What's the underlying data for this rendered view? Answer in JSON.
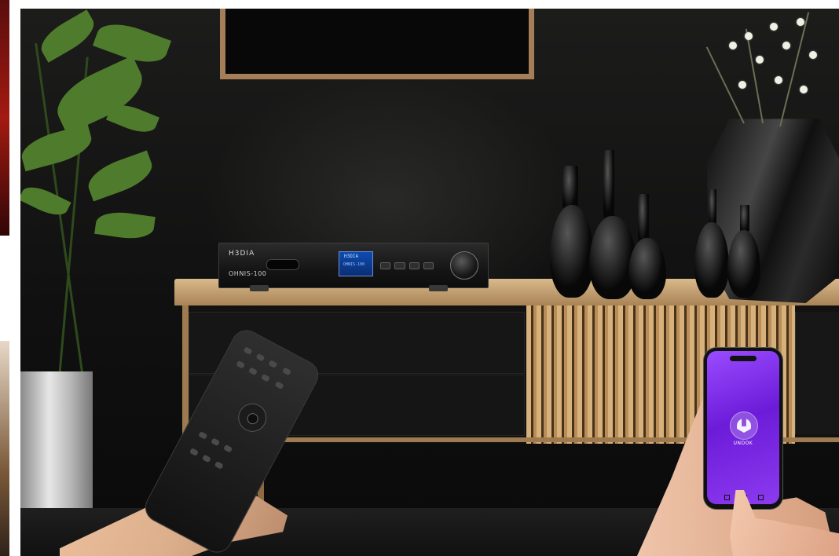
{
  "amp": {
    "brand": "H3DIA",
    "model": "OHNIS-100",
    "display_brand": "H3DIA",
    "display_model": "OHNIS-100"
  },
  "phone": {
    "app_label": "UNDOK"
  },
  "colors": {
    "wall": "#141414",
    "wood": "#b98d58",
    "phone_screen": "#7d2ee6",
    "amp_display": "#0d4bb0"
  }
}
